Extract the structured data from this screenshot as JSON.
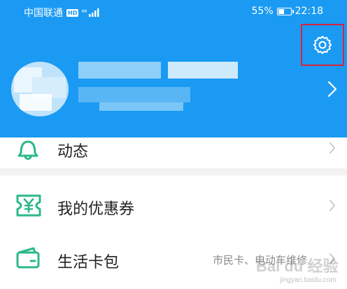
{
  "status_bar": {
    "carrier": "中国联通",
    "network_badge": "HD",
    "signal": "⁴⁶",
    "battery_percent": "55%",
    "battery_level": 0.55,
    "time": "22:18"
  },
  "header": {
    "background_color": "#1a9af3",
    "settings_icon": "gear-icon",
    "settings_highlight_color": "#d8233d",
    "profile_chevron_icon": "chevron-right-icon"
  },
  "menu": {
    "activity": {
      "label": "动态",
      "icon": "bell-icon"
    },
    "coupons": {
      "label": "我的优惠券",
      "icon": "coupon-yen-icon",
      "icon_color": "#2cb88a"
    },
    "wallet": {
      "label": "生活卡包",
      "subtitle": "市民卡、电动车维修",
      "icon": "wallet-icon",
      "icon_color": "#2cb88a"
    }
  },
  "watermark": {
    "text": "Bai du 经验",
    "sub": "jingyan.baidu.com"
  }
}
